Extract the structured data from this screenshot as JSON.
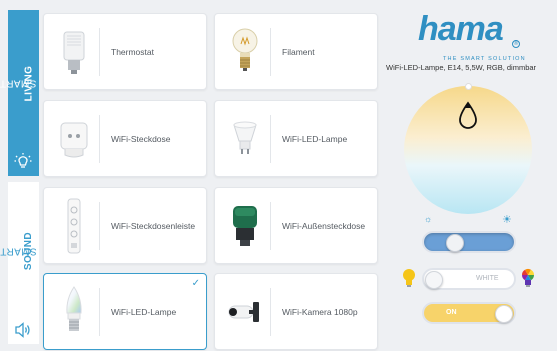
{
  "sidebar": {
    "living": {
      "prefix": "SMART ",
      "strong": "LIVING"
    },
    "sound": {
      "prefix": "SMART ",
      "strong": "SOUND"
    },
    "active_color": "#3a9dcc"
  },
  "devices": [
    {
      "label": "Thermostat",
      "icon": "thermostat-icon"
    },
    {
      "label": "Filament",
      "icon": "filament-bulb-icon"
    },
    {
      "label": "WiFi-Steckdose",
      "icon": "socket-plug-icon"
    },
    {
      "label": "WiFi-LED-Lampe",
      "icon": "gu10-bulb-icon"
    },
    {
      "label": "WiFi-Steckdosenleiste",
      "icon": "power-strip-icon"
    },
    {
      "label": "WiFi-Außensteckdose",
      "icon": "outdoor-socket-icon"
    },
    {
      "label": "WiFi-LED-Lampe",
      "icon": "candle-bulb-icon",
      "selected": true,
      "check": "✓"
    },
    {
      "label": "WiFi-Kamera 1080p",
      "icon": "camera-icon"
    }
  ],
  "brand": {
    "name": "hama",
    "tagline": "THE SMART SOLUTION",
    "reg": "®",
    "color": "#2f8fc2"
  },
  "product_title": "WiFi-LED-Lampe, E14, 5,5W, RGB, dimmbar",
  "controls": {
    "brightness_level": 0.3,
    "white_toggle": {
      "label": "WHITE",
      "on": false
    },
    "power_toggle": {
      "label": "ON",
      "on": true,
      "color": "#f7d36a"
    }
  }
}
